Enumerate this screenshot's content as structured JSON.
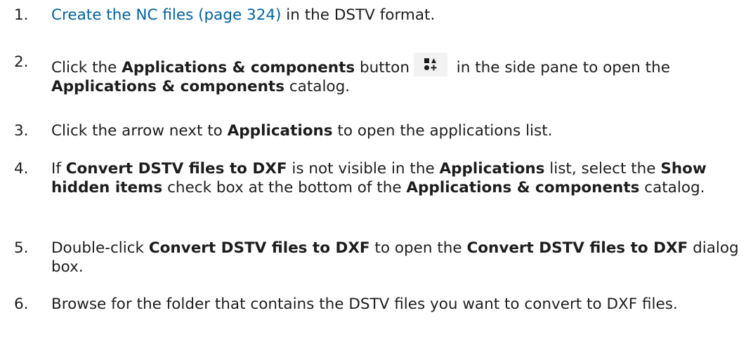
{
  "steps": [
    {
      "num": "1.",
      "link": "Create the NC files (page 324)",
      "rest": " in the DSTV format."
    },
    {
      "num": "2.",
      "t1": "Click the ",
      "b1": "Applications & components",
      "t2": " button",
      "icon": "applications-components-icon",
      "t3": " in the side pane to open the ",
      "b2": "Applications & components",
      "t4": " catalog."
    },
    {
      "num": "3.",
      "t1": "Click the arrow next to ",
      "b1": "Applications",
      "t2": " to open the applications list."
    },
    {
      "num": "4.",
      "t1": "If ",
      "b1": "Convert DSTV files to DXF",
      "t2": " is not visible in the ",
      "b2": "Applications",
      "t3": " list, select the ",
      "b3": "Show hidden items",
      "t4": " check box at the bottom of the ",
      "b4": "Applications & components",
      "t5": " catalog."
    },
    {
      "num": "5.",
      "t1": "Double-click ",
      "b1": "Convert DSTV files to DXF",
      "t2": " to open the ",
      "b2": "Convert DSTV files to DXF",
      "t3": " dialog box."
    },
    {
      "num": "6.",
      "t1": "Browse for the folder that contains the DSTV files you want to convert to DXF files."
    }
  ]
}
